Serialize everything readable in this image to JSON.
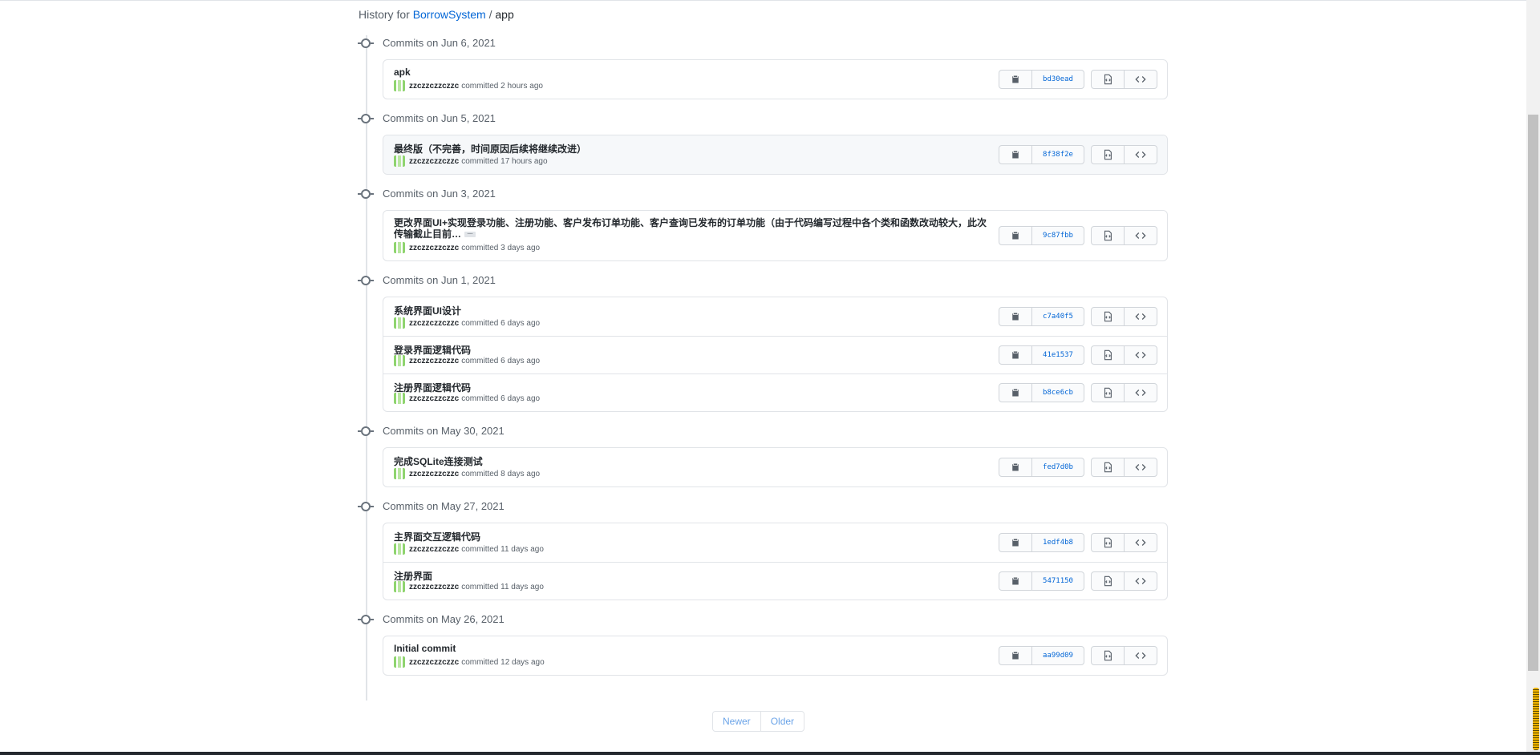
{
  "header": {
    "history_for": "History for",
    "repo": "BorrowSystem",
    "separator": "/",
    "path": "app"
  },
  "groups": [
    {
      "date": "Commits on Jun 6, 2021",
      "commits": [
        {
          "message": "apk",
          "author": "zzczzczzczzc",
          "committed": "committed 2 hours ago",
          "sha": "bd30ead"
        }
      ]
    },
    {
      "date": "Commits on Jun 5, 2021",
      "commits": [
        {
          "message": "最终版（不完善，时间原因后续将继续改进）",
          "author": "zzczzczzczzc",
          "committed": "committed 17 hours ago",
          "sha": "8f38f2e"
        }
      ]
    },
    {
      "date": "Commits on Jun 3, 2021",
      "commits": [
        {
          "message": "更改界面UI+实现登录功能、注册功能、客户发布订单功能、客户查询已发布的订单功能（由于代码编写过程中各个类和函数改动较大，此次传输截止目前…",
          "author": "zzczzczzczzc",
          "committed": "committed 3 days ago",
          "sha": "9c87fbb",
          "ellipsis": "…"
        }
      ]
    },
    {
      "date": "Commits on Jun 1, 2021",
      "commits": [
        {
          "message": "系统界面UI设计",
          "author": "zzczzczzczzc",
          "committed": "committed 6 days ago",
          "sha": "c7a40f5"
        },
        {
          "message": "登录界面逻辑代码",
          "author": "zzczzczzczzc",
          "committed": "committed 6 days ago",
          "sha": "41e1537"
        },
        {
          "message": "注册界面逻辑代码",
          "author": "zzczzczzczzc",
          "committed": "committed 6 days ago",
          "sha": "b8ce6cb"
        }
      ]
    },
    {
      "date": "Commits on May 30, 2021",
      "commits": [
        {
          "message": "完成SQLite连接测试",
          "author": "zzczzczzczzc",
          "committed": "committed 8 days ago",
          "sha": "fed7d0b"
        }
      ]
    },
    {
      "date": "Commits on May 27, 2021",
      "commits": [
        {
          "message": "主界面交互逻辑代码",
          "author": "zzczzczzczzc",
          "committed": "committed 11 days ago",
          "sha": "1edf4b8"
        },
        {
          "message": "注册界面",
          "author": "zzczzczzczzc",
          "committed": "committed 11 days ago",
          "sha": "5471150"
        }
      ]
    },
    {
      "date": "Commits on May 26, 2021",
      "commits": [
        {
          "message": "Initial commit",
          "author": "zzczzczzczzc",
          "committed": "committed 12 days ago",
          "sha": "aa99d09"
        }
      ]
    }
  ],
  "pagination": {
    "newer": "Newer",
    "older": "Older"
  },
  "icons": {
    "copy": "clipboard-icon",
    "browse": "file-code-icon",
    "code": "code-icon",
    "timeline": "git-commit-icon"
  },
  "colors": {
    "link": "#0366d6",
    "border": "#e1e4e8",
    "muted": "#586069",
    "avatar": "#8fd46f"
  }
}
